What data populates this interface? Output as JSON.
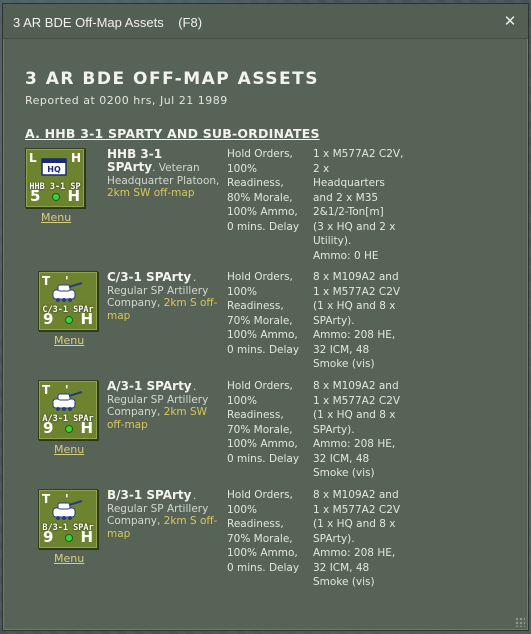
{
  "window": {
    "title": "3 AR BDE Off-Map Assets    (F8)",
    "close_glyph": "✕"
  },
  "report": {
    "title": "3 AR BDE OFF-MAP ASSETS",
    "subtitle": "Reported at 0200 hrs, Jul 21 1989"
  },
  "section": {
    "heading": "A. HHB 3-1 SPARTY AND SUB-ORDINATES"
  },
  "units": [
    {
      "icon": "hq-unit-icon",
      "counter": {
        "tl": "L",
        "tr": "H",
        "id": "HHB 3-1 SP",
        "bl": "5",
        "br": "H"
      },
      "menu": "Menu",
      "name_line1": "HHB 3-1",
      "name_line2": "SPArty",
      "desc": ". Veteran Headquarter Platoon, ",
      "location": "2km SW off-map",
      "orders": "Hold Orders,\n100%\nReadiness,\n80% Morale,\n100% Ammo,\n0 mins. Delay",
      "equipment": "1 x M577A2 C2V,\n2 x\nHeadquarters\nand 2 x M35\n2&1/2-Ton[m]\n(3 x HQ and 2 x\nUtility).\nAmmo: 0 HE"
    },
    {
      "icon": "sp-artillery-icon",
      "counter": {
        "tl": "T",
        "tr": "'",
        "id": "C/3-1 SPAr",
        "bl": "9",
        "br": "H"
      },
      "menu": "Menu",
      "name_line1": "C/3-1 SPArty",
      "name_line2": "",
      "desc": ". Regular SP Artillery Company, ",
      "location": "2km S off-map",
      "orders": "Hold Orders,\n100%\nReadiness,\n70% Morale,\n100% Ammo,\n0 mins. Delay",
      "equipment": "8 x M109A2 and\n1 x M577A2 C2V\n(1 x HQ and 8 x\nSPArty).\nAmmo: 208 HE,\n32 ICM, 48\nSmoke (vis)"
    },
    {
      "icon": "sp-artillery-icon",
      "counter": {
        "tl": "T",
        "tr": "'",
        "id": "A/3-1 SPAr",
        "bl": "9",
        "br": "H"
      },
      "menu": "Menu",
      "name_line1": "A/3-1 SPArty",
      "name_line2": "",
      "desc": ". Regular SP Artillery Company, ",
      "location": "2km SW off-map",
      "orders": "Hold Orders,\n100%\nReadiness,\n70% Morale,\n100% Ammo,\n0 mins. Delay",
      "equipment": "8 x M109A2 and\n1 x M577A2 C2V\n(1 x HQ and 8 x\nSPArty).\nAmmo: 208 HE,\n32 ICM, 48\nSmoke (vis)"
    },
    {
      "icon": "sp-artillery-icon",
      "counter": {
        "tl": "T",
        "tr": "'",
        "id": "B/3-1 SPAr",
        "bl": "9",
        "br": "H"
      },
      "menu": "Menu",
      "name_line1": "B/3-1 SPArty",
      "name_line2": "",
      "desc": ". Regular SP Artillery Company, ",
      "location": "2km S off-map",
      "orders": "Hold Orders,\n100%\nReadiness,\n70% Morale,\n100% Ammo,\n0 mins. Delay",
      "equipment": "8 x M109A2 and\n1 x M577A2 C2V\n(1 x HQ and 8 x\nSPArty).\nAmmo: 208 HE,\n32 ICM, 48\nSmoke (vis)"
    }
  ],
  "colors": {
    "window_bg": "#576357",
    "counter_green": "#6e8330",
    "location_yellow": "#d9c75a",
    "menu_link": "#d8cf7a",
    "status_dot": "#3bd33b"
  }
}
